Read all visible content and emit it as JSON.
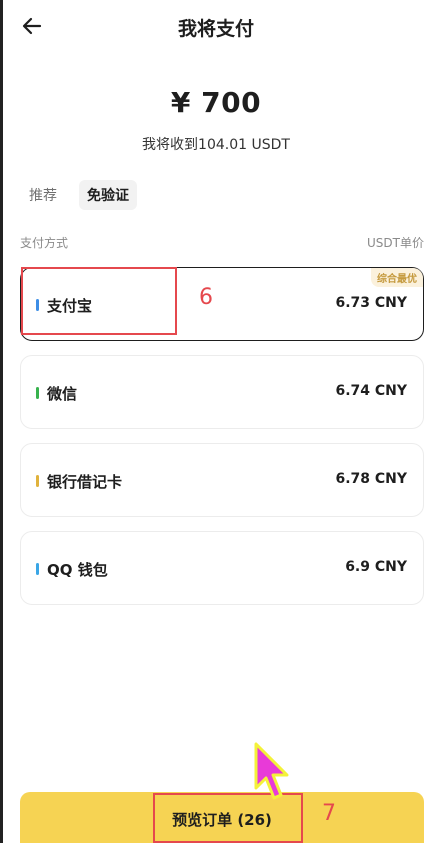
{
  "header": {
    "title": "我将支付"
  },
  "amount": "¥ 700",
  "receive_text": "我将收到104.01 USDT",
  "tabs": [
    {
      "label": "推荐",
      "active": false
    },
    {
      "label": "免验证",
      "active": true
    }
  ],
  "list_header": {
    "left": "支付方式",
    "right": "USDT单价"
  },
  "methods": [
    {
      "name": "支付宝",
      "price": "6.73 CNY",
      "color": "#3d8ee6",
      "badge": "综合最优",
      "selected": true
    },
    {
      "name": "微信",
      "price": "6.74 CNY",
      "color": "#37b24d"
    },
    {
      "name": "银行借记卡",
      "price": "6.78 CNY",
      "color": "#e0b23c"
    },
    {
      "name": "QQ 钱包",
      "price": "6.9 CNY",
      "color": "#3aa6e6"
    }
  ],
  "preview_button": "预览订单 (26)",
  "annotations": {
    "step6": "6",
    "step7": "7"
  },
  "colors": {
    "accent_yellow": "#f6d353",
    "annotation_red": "#e5484d",
    "cursor_magenta": "#e83ad8"
  }
}
